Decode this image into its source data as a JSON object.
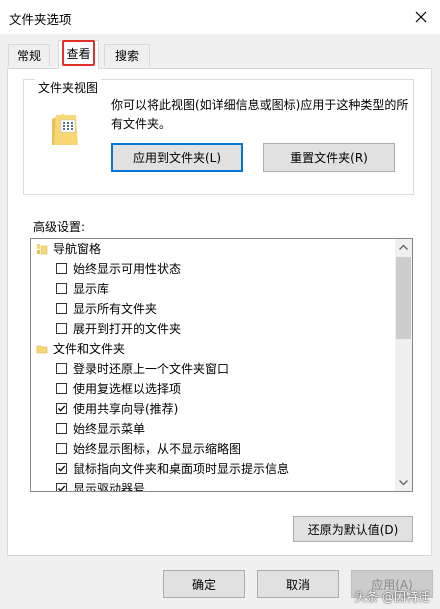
{
  "window": {
    "title": "文件夹选项"
  },
  "tabs": [
    {
      "label": "常规"
    },
    {
      "label": "查看"
    },
    {
      "label": "搜索"
    }
  ],
  "folder_view": {
    "group_label": "文件夹视图",
    "description": "你可以将此视图(如详细信息或图标)应用于这种类型的所有文件夹。",
    "apply_button": "应用到文件夹(L)",
    "reset_button": "重置文件夹(R)"
  },
  "advanced": {
    "label": "高级设置:",
    "items": [
      {
        "type": "category",
        "icon": "navigation-pane-icon",
        "label": "导航窗格"
      },
      {
        "type": "checkbox",
        "checked": false,
        "label": "始终显示可用性状态"
      },
      {
        "type": "checkbox",
        "checked": false,
        "label": "显示库"
      },
      {
        "type": "checkbox",
        "checked": false,
        "label": "显示所有文件夹"
      },
      {
        "type": "checkbox",
        "checked": false,
        "label": "展开到打开的文件夹"
      },
      {
        "type": "category",
        "icon": "folder-icon",
        "label": "文件和文件夹"
      },
      {
        "type": "checkbox",
        "checked": false,
        "label": "登录时还原上一个文件夹窗口"
      },
      {
        "type": "checkbox",
        "checked": false,
        "label": "使用复选框以选择项"
      },
      {
        "type": "checkbox",
        "checked": true,
        "label": "使用共享向导(推荐)"
      },
      {
        "type": "checkbox",
        "checked": false,
        "label": "始终显示菜单"
      },
      {
        "type": "checkbox",
        "checked": false,
        "label": "始终显示图标，从不显示缩略图"
      },
      {
        "type": "checkbox",
        "checked": true,
        "label": "鼠标指向文件夹和桌面项时显示提示信息"
      },
      {
        "type": "checkbox",
        "checked": true,
        "label": "显示驱动器号"
      }
    ],
    "restore_defaults": "还原为默认值(D)"
  },
  "footer": {
    "ok": "确定",
    "cancel": "取消",
    "apply": "应用(A)"
  },
  "watermark": "头条 @因特迁",
  "colors": {
    "highlight_box": "#e0312b",
    "default_button_border": "#0078d7",
    "folder_yellow": "#f8d775"
  }
}
